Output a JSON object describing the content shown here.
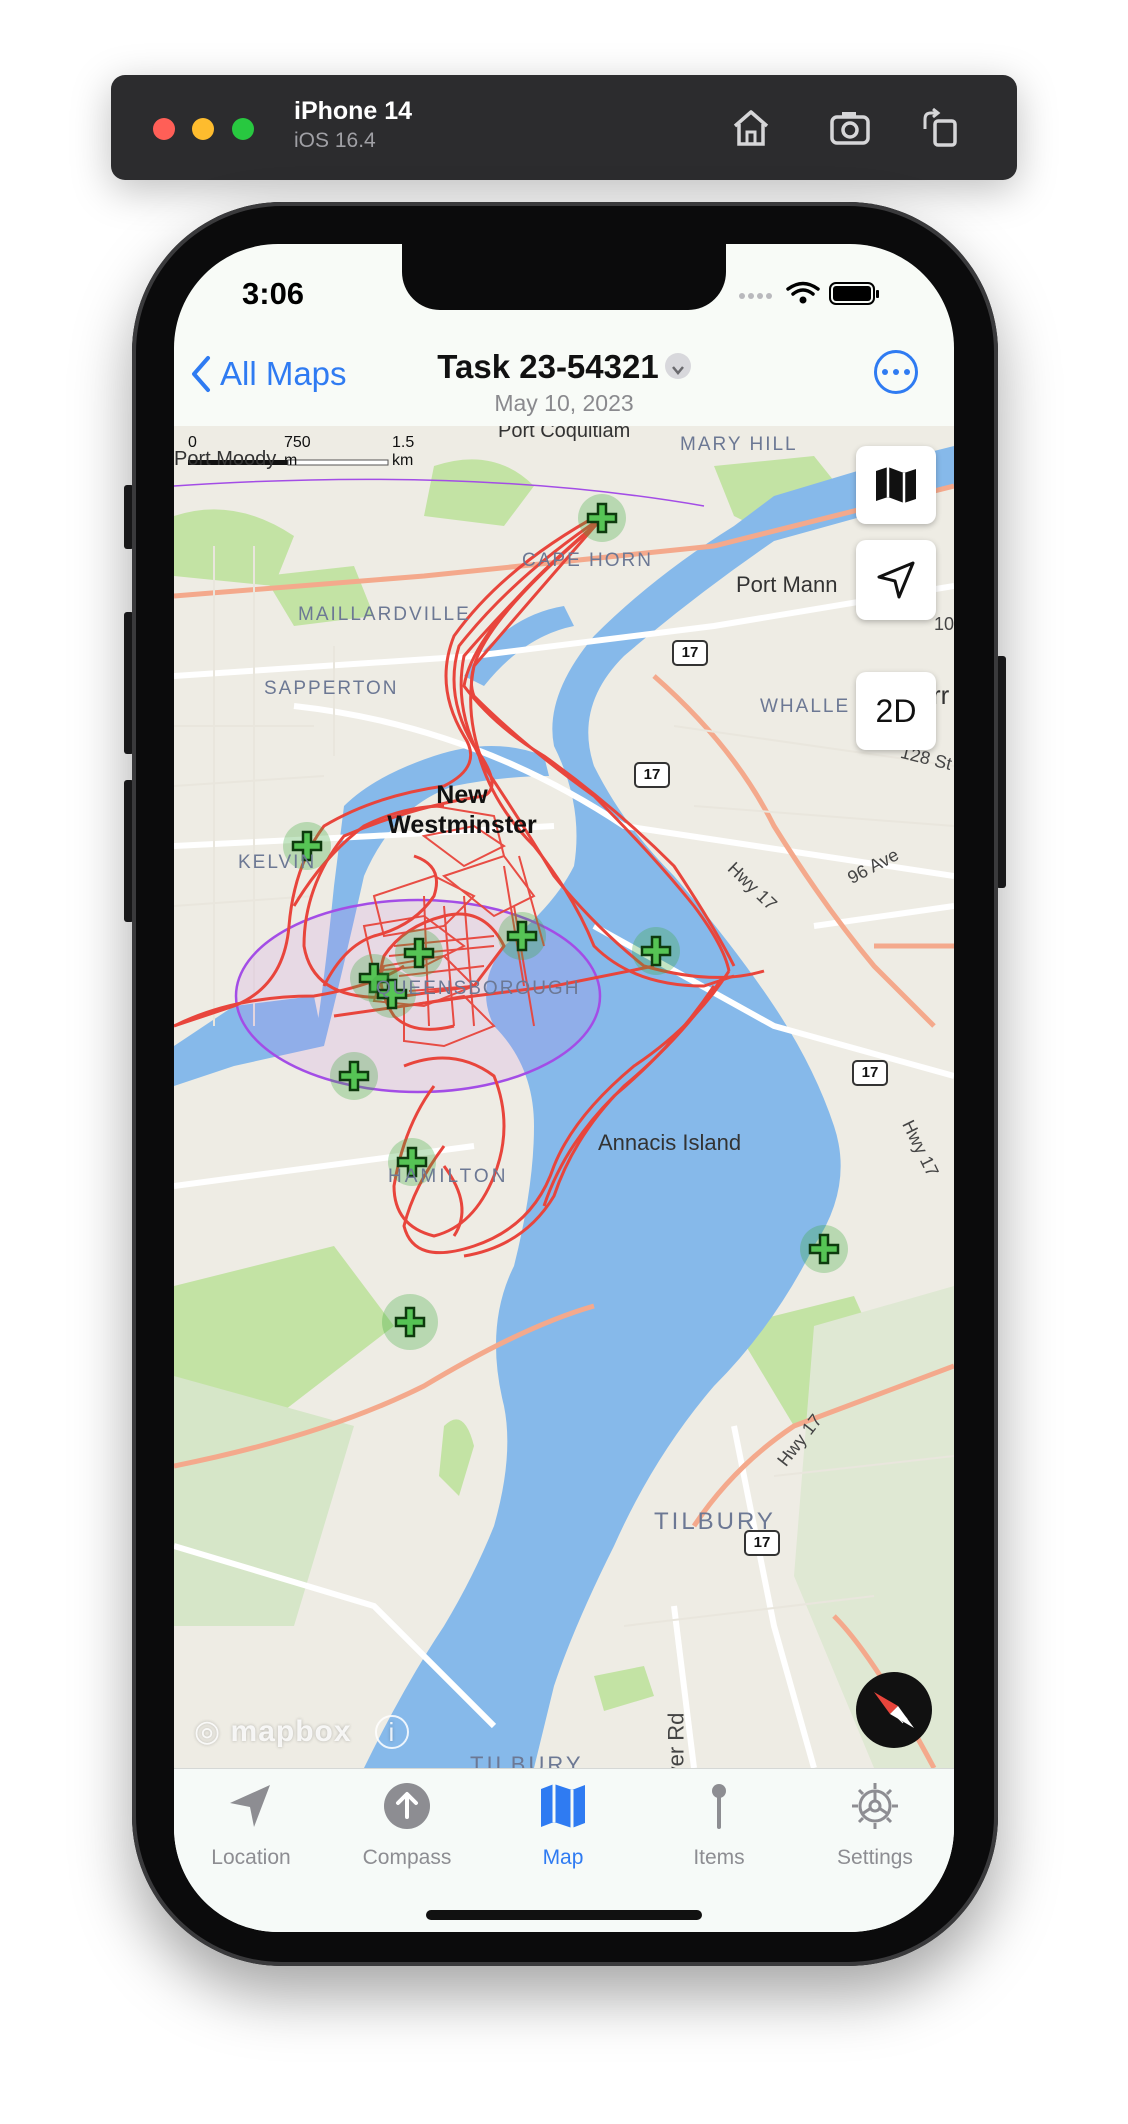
{
  "simulator": {
    "device_name": "iPhone 14",
    "os_version": "iOS 16.4",
    "buttons": [
      "home-icon",
      "screenshot-icon",
      "rotate-icon"
    ]
  },
  "status_bar": {
    "time": "3:06"
  },
  "nav": {
    "back_label": "All Maps",
    "title": "Task 23-54321",
    "subtitle": "May 10, 2023"
  },
  "map": {
    "scale": {
      "zero": "0",
      "mid": "750 m",
      "max": "1.5 km"
    },
    "labels": {
      "port_moody": "Port Moody",
      "port_coquitlam": "Port Coquitlam",
      "mary_hill": "MARY HILL",
      "cape_horn": "CAPE HORN",
      "maillardville": "MAILLARDVILLE",
      "port_mann": "Port Mann",
      "sapperton": "SAPPERTON",
      "whalley": "WHALLE",
      "new_westminster": "New Westminster",
      "kelvin": "KELVIN",
      "queensborough": "QUEENSBOROUGH",
      "annacis_island": "Annacis Island",
      "hamilton": "HAMILTON",
      "tilbury": "TILBURY",
      "tilbury_bottom": "TILBURY",
      "ave_96": "96 Ave",
      "st_128": "128 St",
      "hwy17_a": "Hwy 17",
      "hwy17_b": "Hwy 17",
      "hwy17_c": "Hwy 17",
      "river_rd": "ver Rd",
      "edge_10": "10",
      "edge_rr": "rr"
    },
    "shields": [
      "17",
      "17",
      "17",
      "17"
    ],
    "controls": {
      "mode_2d": "2D"
    },
    "attribution": "mapbox",
    "colors": {
      "water": "#86b9ea",
      "track": "#e8453c",
      "park": "#c3e3a4",
      "waypoint": "#3aa83a",
      "geofence": "#a34de6"
    }
  },
  "tabs": [
    {
      "label": "Location",
      "icon": "location-arrow-icon",
      "active": false
    },
    {
      "label": "Compass",
      "icon": "compass-arrow-icon",
      "active": false
    },
    {
      "label": "Map",
      "icon": "map-icon",
      "active": true
    },
    {
      "label": "Items",
      "icon": "pin-icon",
      "active": false
    },
    {
      "label": "Settings",
      "icon": "gear-icon",
      "active": false
    }
  ]
}
